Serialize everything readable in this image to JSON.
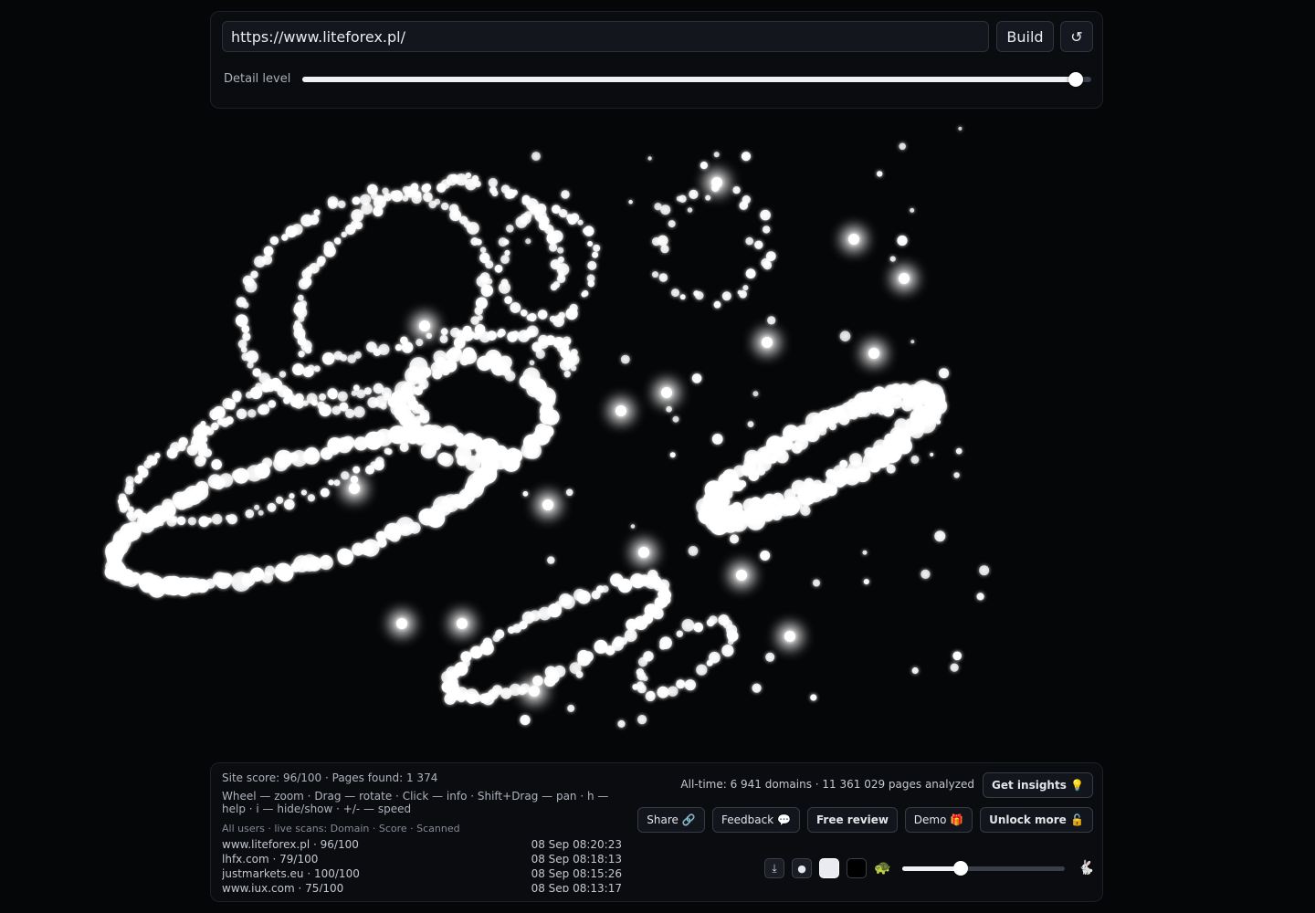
{
  "url_input": {
    "value": "https://www.liteforex.pl/"
  },
  "controls": {
    "build_label": "Build",
    "reset_icon": "↺",
    "detail_label": "Detail level",
    "detail_level": 0.98
  },
  "stats": {
    "site_line": "Site score: 96/100 · Pages found: 1 374",
    "help_text": "Wheel — zoom · Drag — rotate · Click — info · Shift+Drag — pan · h — help · i — hide/show · +/- — speed",
    "scans_header": "All users · live scans: Domain · Score · Scanned",
    "all_time": "All-time: 6 941 domains · 11 361 029 pages analyzed"
  },
  "scans": [
    {
      "domain": "www.liteforex.pl · 96/100",
      "time": "08 Sep 08:20:23"
    },
    {
      "domain": "lhfx.com · 79/100",
      "time": "08 Sep 08:18:13"
    },
    {
      "domain": "justmarkets.eu · 100/100",
      "time": "08 Sep 08:15:26"
    },
    {
      "domain": "www.iux.com · 75/100",
      "time": "08 Sep 08:13:17"
    }
  ],
  "buttons": {
    "insights": "Get insights 💡",
    "share": "Share 🔗",
    "feedback": "Feedback 💬",
    "free_review": "Free review",
    "demo": "Demo 🎁",
    "unlock": "Unlock more 🔓"
  },
  "toolbar": {
    "download_icon": "⤓",
    "dot_icon": "●",
    "turtle_icon": "🐢",
    "rabbit_icon": "🐇",
    "speed_level": 0.36
  },
  "colors": {
    "background": "#050608",
    "particle": "#ffffff",
    "panel": "#0a0c10"
  }
}
